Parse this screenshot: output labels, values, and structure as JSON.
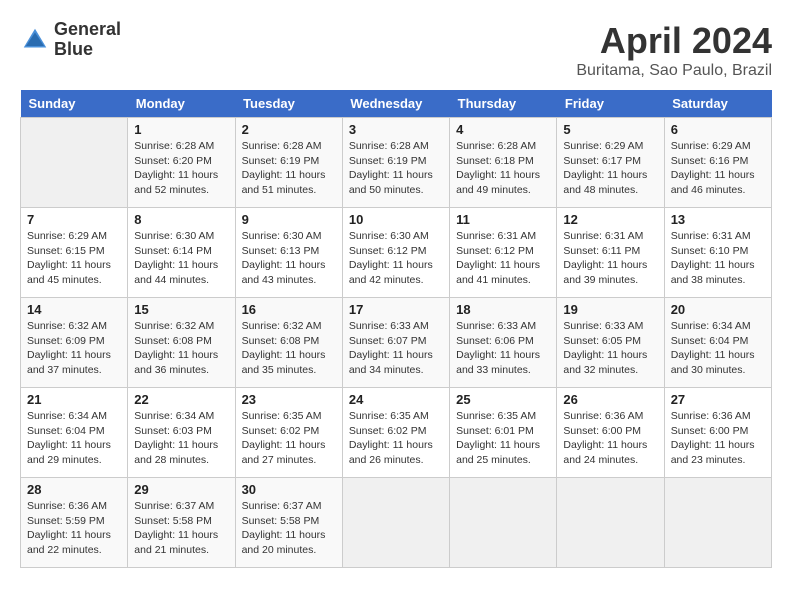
{
  "header": {
    "logo_line1": "General",
    "logo_line2": "Blue",
    "title": "April 2024",
    "location": "Buritama, Sao Paulo, Brazil"
  },
  "calendar": {
    "days_of_week": [
      "Sunday",
      "Monday",
      "Tuesday",
      "Wednesday",
      "Thursday",
      "Friday",
      "Saturday"
    ],
    "weeks": [
      [
        {
          "day": "",
          "sunrise": "",
          "sunset": "",
          "daylight": ""
        },
        {
          "day": "1",
          "sunrise": "Sunrise: 6:28 AM",
          "sunset": "Sunset: 6:20 PM",
          "daylight": "Daylight: 11 hours and 52 minutes."
        },
        {
          "day": "2",
          "sunrise": "Sunrise: 6:28 AM",
          "sunset": "Sunset: 6:19 PM",
          "daylight": "Daylight: 11 hours and 51 minutes."
        },
        {
          "day": "3",
          "sunrise": "Sunrise: 6:28 AM",
          "sunset": "Sunset: 6:19 PM",
          "daylight": "Daylight: 11 hours and 50 minutes."
        },
        {
          "day": "4",
          "sunrise": "Sunrise: 6:28 AM",
          "sunset": "Sunset: 6:18 PM",
          "daylight": "Daylight: 11 hours and 49 minutes."
        },
        {
          "day": "5",
          "sunrise": "Sunrise: 6:29 AM",
          "sunset": "Sunset: 6:17 PM",
          "daylight": "Daylight: 11 hours and 48 minutes."
        },
        {
          "day": "6",
          "sunrise": "Sunrise: 6:29 AM",
          "sunset": "Sunset: 6:16 PM",
          "daylight": "Daylight: 11 hours and 46 minutes."
        }
      ],
      [
        {
          "day": "7",
          "sunrise": "Sunrise: 6:29 AM",
          "sunset": "Sunset: 6:15 PM",
          "daylight": "Daylight: 11 hours and 45 minutes."
        },
        {
          "day": "8",
          "sunrise": "Sunrise: 6:30 AM",
          "sunset": "Sunset: 6:14 PM",
          "daylight": "Daylight: 11 hours and 44 minutes."
        },
        {
          "day": "9",
          "sunrise": "Sunrise: 6:30 AM",
          "sunset": "Sunset: 6:13 PM",
          "daylight": "Daylight: 11 hours and 43 minutes."
        },
        {
          "day": "10",
          "sunrise": "Sunrise: 6:30 AM",
          "sunset": "Sunset: 6:12 PM",
          "daylight": "Daylight: 11 hours and 42 minutes."
        },
        {
          "day": "11",
          "sunrise": "Sunrise: 6:31 AM",
          "sunset": "Sunset: 6:12 PM",
          "daylight": "Daylight: 11 hours and 41 minutes."
        },
        {
          "day": "12",
          "sunrise": "Sunrise: 6:31 AM",
          "sunset": "Sunset: 6:11 PM",
          "daylight": "Daylight: 11 hours and 39 minutes."
        },
        {
          "day": "13",
          "sunrise": "Sunrise: 6:31 AM",
          "sunset": "Sunset: 6:10 PM",
          "daylight": "Daylight: 11 hours and 38 minutes."
        }
      ],
      [
        {
          "day": "14",
          "sunrise": "Sunrise: 6:32 AM",
          "sunset": "Sunset: 6:09 PM",
          "daylight": "Daylight: 11 hours and 37 minutes."
        },
        {
          "day": "15",
          "sunrise": "Sunrise: 6:32 AM",
          "sunset": "Sunset: 6:08 PM",
          "daylight": "Daylight: 11 hours and 36 minutes."
        },
        {
          "day": "16",
          "sunrise": "Sunrise: 6:32 AM",
          "sunset": "Sunset: 6:08 PM",
          "daylight": "Daylight: 11 hours and 35 minutes."
        },
        {
          "day": "17",
          "sunrise": "Sunrise: 6:33 AM",
          "sunset": "Sunset: 6:07 PM",
          "daylight": "Daylight: 11 hours and 34 minutes."
        },
        {
          "day": "18",
          "sunrise": "Sunrise: 6:33 AM",
          "sunset": "Sunset: 6:06 PM",
          "daylight": "Daylight: 11 hours and 33 minutes."
        },
        {
          "day": "19",
          "sunrise": "Sunrise: 6:33 AM",
          "sunset": "Sunset: 6:05 PM",
          "daylight": "Daylight: 11 hours and 32 minutes."
        },
        {
          "day": "20",
          "sunrise": "Sunrise: 6:34 AM",
          "sunset": "Sunset: 6:04 PM",
          "daylight": "Daylight: 11 hours and 30 minutes."
        }
      ],
      [
        {
          "day": "21",
          "sunrise": "Sunrise: 6:34 AM",
          "sunset": "Sunset: 6:04 PM",
          "daylight": "Daylight: 11 hours and 29 minutes."
        },
        {
          "day": "22",
          "sunrise": "Sunrise: 6:34 AM",
          "sunset": "Sunset: 6:03 PM",
          "daylight": "Daylight: 11 hours and 28 minutes."
        },
        {
          "day": "23",
          "sunrise": "Sunrise: 6:35 AM",
          "sunset": "Sunset: 6:02 PM",
          "daylight": "Daylight: 11 hours and 27 minutes."
        },
        {
          "day": "24",
          "sunrise": "Sunrise: 6:35 AM",
          "sunset": "Sunset: 6:02 PM",
          "daylight": "Daylight: 11 hours and 26 minutes."
        },
        {
          "day": "25",
          "sunrise": "Sunrise: 6:35 AM",
          "sunset": "Sunset: 6:01 PM",
          "daylight": "Daylight: 11 hours and 25 minutes."
        },
        {
          "day": "26",
          "sunrise": "Sunrise: 6:36 AM",
          "sunset": "Sunset: 6:00 PM",
          "daylight": "Daylight: 11 hours and 24 minutes."
        },
        {
          "day": "27",
          "sunrise": "Sunrise: 6:36 AM",
          "sunset": "Sunset: 6:00 PM",
          "daylight": "Daylight: 11 hours and 23 minutes."
        }
      ],
      [
        {
          "day": "28",
          "sunrise": "Sunrise: 6:36 AM",
          "sunset": "Sunset: 5:59 PM",
          "daylight": "Daylight: 11 hours and 22 minutes."
        },
        {
          "day": "29",
          "sunrise": "Sunrise: 6:37 AM",
          "sunset": "Sunset: 5:58 PM",
          "daylight": "Daylight: 11 hours and 21 minutes."
        },
        {
          "day": "30",
          "sunrise": "Sunrise: 6:37 AM",
          "sunset": "Sunset: 5:58 PM",
          "daylight": "Daylight: 11 hours and 20 minutes."
        },
        {
          "day": "",
          "sunrise": "",
          "sunset": "",
          "daylight": ""
        },
        {
          "day": "",
          "sunrise": "",
          "sunset": "",
          "daylight": ""
        },
        {
          "day": "",
          "sunrise": "",
          "sunset": "",
          "daylight": ""
        },
        {
          "day": "",
          "sunrise": "",
          "sunset": "",
          "daylight": ""
        }
      ]
    ]
  }
}
